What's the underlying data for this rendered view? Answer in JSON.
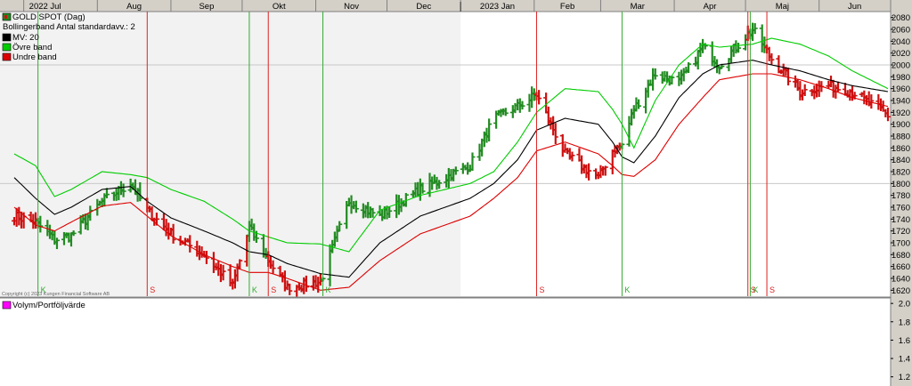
{
  "months": [
    "2022 Jul",
    "Aug",
    "Sep",
    "Okt",
    "Nov",
    "Dec",
    "2023 Jan",
    "Feb",
    "Mar",
    "Apr",
    "Maj",
    "Jun"
  ],
  "legend": {
    "instrument": "GOLD SPOT (Dag)",
    "indicator": "Bollingerband  Antal standardavv.: 2",
    "mv": "MV: 20",
    "upper": "Övre band",
    "lower": "Undre band"
  },
  "copyright": "Copyright (c) 2023 Kungen Financial Software AB",
  "lower_panel": {
    "legend": "Volym/Portföljvärde"
  },
  "colors": {
    "bull": "#228b22",
    "bear": "#cc1111",
    "ma": "#000000",
    "upper_band": "#00cc00",
    "lower_band": "#dd0000",
    "signal_buy": "#33aa33",
    "signal_sell": "#dd2222",
    "pane_shade": "#f2f2f2",
    "panel_legend": "#ff00ff"
  },
  "chart_data": [
    {
      "type": "line",
      "title": "GOLD SPOT (Dag)",
      "y_axis": {
        "min": 1610,
        "max": 2090,
        "ticks": [
          1620,
          1640,
          1660,
          1680,
          1700,
          1720,
          1740,
          1760,
          1780,
          1800,
          1820,
          1840,
          1860,
          1880,
          1900,
          1920,
          1940,
          1960,
          1980,
          2000,
          2020,
          2040,
          2060,
          2080
        ]
      },
      "grid_lines": [
        1800,
        2000
      ],
      "x_axis": {
        "months": [
          "2022 Jul",
          "Aug",
          "Sep",
          "Okt",
          "Nov",
          "Dec",
          "2023 Jan",
          "Feb",
          "Mar",
          "Apr",
          "Maj",
          "Jun"
        ]
      },
      "price_anchors": [
        [
          "2022-06-27",
          1745
        ],
        [
          "2022-07-06",
          1735
        ],
        [
          "2022-07-14",
          1705
        ],
        [
          "2022-07-21",
          1712
        ],
        [
          "2022-08-03",
          1770
        ],
        [
          "2022-08-15",
          1800
        ],
        [
          "2022-08-22",
          1755
        ],
        [
          "2022-09-01",
          1715
        ],
        [
          "2022-09-15",
          1680
        ],
        [
          "2022-09-27",
          1628
        ],
        [
          "2022-10-04",
          1725
        ],
        [
          "2022-10-12",
          1670
        ],
        [
          "2022-10-20",
          1625
        ],
        [
          "2022-11-03",
          1634
        ],
        [
          "2022-11-15",
          1770
        ],
        [
          "2022-11-28",
          1745
        ],
        [
          "2022-12-15",
          1790
        ],
        [
          "2023-01-05",
          1830
        ],
        [
          "2023-01-15",
          1910
        ],
        [
          "2023-01-25",
          1930
        ],
        [
          "2023-02-02",
          1950
        ],
        [
          "2023-02-14",
          1850
        ],
        [
          "2023-02-28",
          1810
        ],
        [
          "2023-03-06",
          1855
        ],
        [
          "2023-03-10",
          1865
        ],
        [
          "2023-03-15",
          1925
        ],
        [
          "2023-03-24",
          1985
        ],
        [
          "2023-04-03",
          1970
        ],
        [
          "2023-04-13",
          2030
        ],
        [
          "2023-04-20",
          2000
        ],
        [
          "2023-05-04",
          2060
        ],
        [
          "2023-05-12",
          2010
        ],
        [
          "2023-05-24",
          1955
        ],
        [
          "2023-06-05",
          1965
        ],
        [
          "2023-06-15",
          1955
        ],
        [
          "2023-06-30",
          1915
        ]
      ],
      "series": [
        {
          "name": "MV: 20",
          "values": [
            1810,
            1775,
            1748,
            1760,
            1790,
            1795,
            1770,
            1742,
            1720,
            1700,
            1685,
            1680,
            1665,
            1648,
            1642,
            1700,
            1745,
            1775,
            1800,
            1840,
            1890,
            1910,
            1900,
            1870,
            1845,
            1835,
            1880,
            1945,
            1985,
            2000,
            2008,
            2000,
            1990,
            1975,
            1965,
            1955
          ]
        },
        {
          "name": "Övre band",
          "values": [
            1850,
            1830,
            1778,
            1790,
            1820,
            1815,
            1810,
            1790,
            1770,
            1740,
            1720,
            1710,
            1700,
            1698,
            1685,
            1755,
            1780,
            1800,
            1820,
            1870,
            1920,
            1960,
            1955,
            1925,
            1900,
            1860,
            1940,
            2000,
            2035,
            2030,
            2035,
            2045,
            2035,
            2015,
            1990,
            1960
          ]
        },
        {
          "name": "Undre band",
          "values": [
            1760,
            1730,
            1720,
            1735,
            1762,
            1768,
            1745,
            1712,
            1680,
            1660,
            1650,
            1650,
            1640,
            1620,
            1625,
            1670,
            1715,
            1745,
            1775,
            1810,
            1855,
            1870,
            1850,
            1830,
            1815,
            1812,
            1840,
            1900,
            1945,
            1975,
            1985,
            1985,
            1975,
            1960,
            1945,
            1930
          ]
        }
      ],
      "signals": [
        {
          "date": "2022-07-07",
          "label": "K"
        },
        {
          "date": "2022-08-22",
          "label": "S"
        },
        {
          "date": "2022-10-04",
          "label": "K"
        },
        {
          "date": "2022-10-12",
          "label": "S"
        },
        {
          "date": "2022-11-04",
          "label": "K"
        },
        {
          "date": "2023-02-02",
          "label": "S"
        },
        {
          "date": "2023-03-10",
          "label": "K"
        },
        {
          "date": "2023-05-02",
          "label": "S"
        },
        {
          "date": "2023-05-03",
          "label": "K"
        },
        {
          "date": "2023-05-10",
          "label": "S"
        }
      ]
    },
    {
      "type": "line",
      "title": "Volym/Portföljvärde",
      "y_axis": {
        "min": 1.1,
        "max": 2.05,
        "ticks": [
          1.2,
          1.4,
          1.6,
          1.8,
          2.0
        ]
      },
      "series": []
    }
  ]
}
